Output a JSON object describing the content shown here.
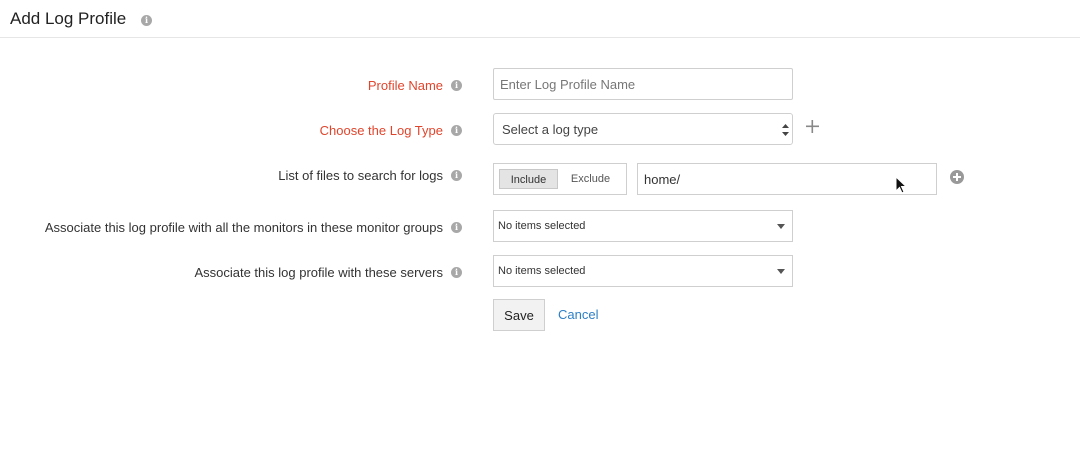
{
  "header": {
    "title": "Add Log Profile"
  },
  "form": {
    "profile_name": {
      "label": "Profile Name",
      "placeholder": "Enter Log Profile Name",
      "value": ""
    },
    "log_type": {
      "label": "Choose the Log Type",
      "selected": "Select a log type"
    },
    "files": {
      "label": "List of files to search for logs",
      "include_label": "Include",
      "exclude_label": "Exclude",
      "active_toggle": "Include",
      "path_value": "home/"
    },
    "monitor_groups": {
      "label": "Associate this log profile with all the monitors in these monitor groups",
      "selected": "No items selected"
    },
    "servers": {
      "label": "Associate this log profile with these servers",
      "selected": "No items selected"
    },
    "actions": {
      "save_label": "Save",
      "cancel_label": "Cancel"
    }
  },
  "icons": {
    "info": "info-icon",
    "add_log_type": "plus-icon",
    "add_path": "add-circle-icon",
    "dropdown": "caret-down-icon"
  },
  "colors": {
    "required_label": "#e0452c",
    "link": "#2d7fc6",
    "info_icon": "#a8a8a8"
  }
}
